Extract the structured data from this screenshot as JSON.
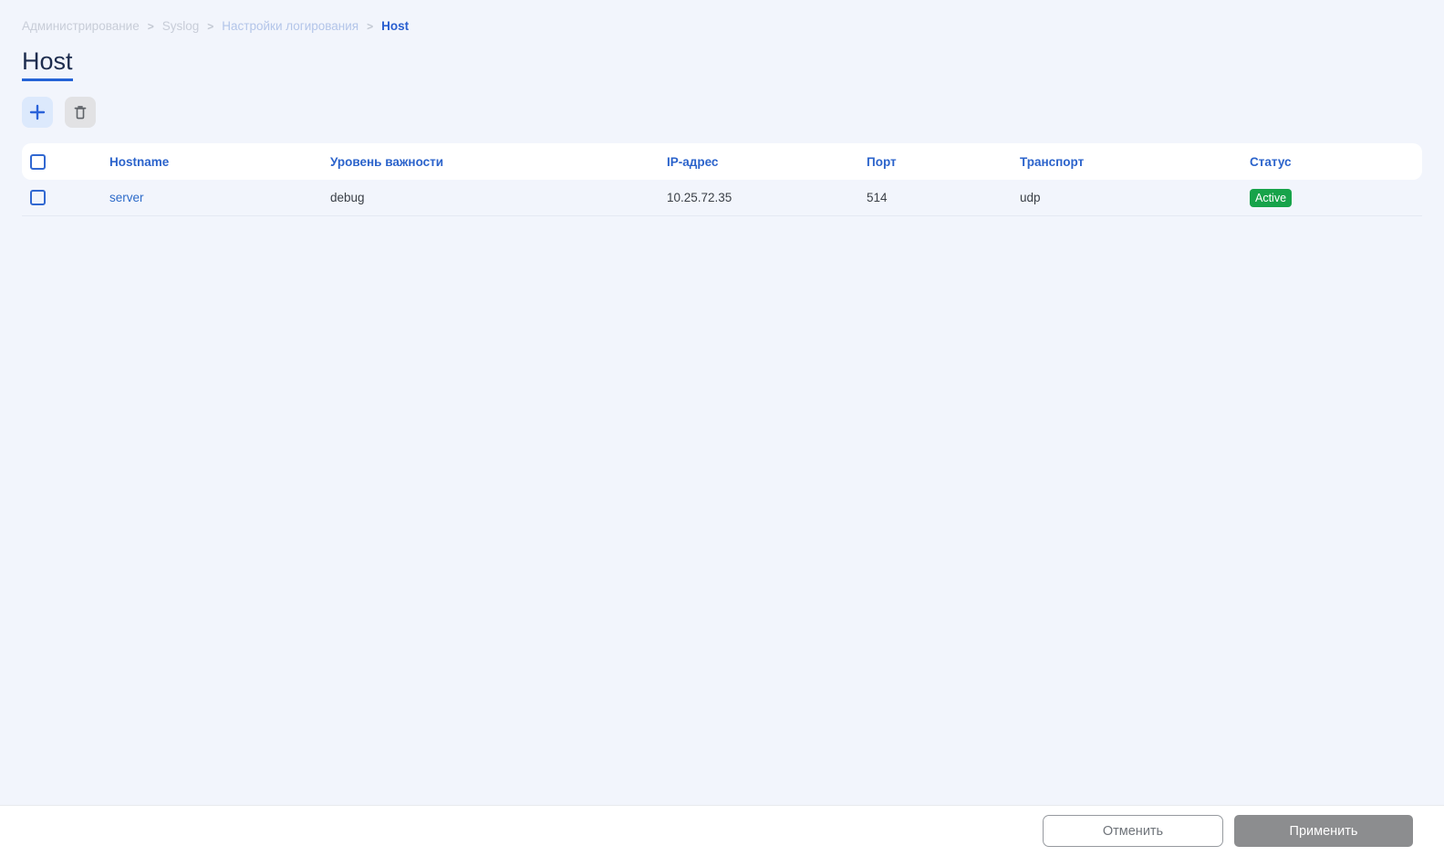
{
  "colors": {
    "accent_blue": "#2a5fd0",
    "badge_green": "#17a34a",
    "page_background": "#f2f5fc"
  },
  "breadcrumb": {
    "separator": ">",
    "items": [
      {
        "label": "Администрирование"
      },
      {
        "label": "Syslog"
      },
      {
        "label": "Настройки логирования"
      },
      {
        "label": "Host"
      }
    ]
  },
  "page": {
    "title": "Host"
  },
  "toolbar": {
    "add_icon": "plus-icon",
    "delete_icon": "trash-icon"
  },
  "table": {
    "columns": [
      "Hostname",
      "Уровень важности",
      "IP-адрес",
      "Порт",
      "Транспорт",
      "Статус"
    ],
    "rows": [
      {
        "hostname": "server",
        "severity": "debug",
        "ip_address": "10.25.72.35",
        "port": "514",
        "transport": "udp",
        "status": "Active"
      }
    ]
  },
  "footer": {
    "cancel_label": "Отменить",
    "apply_label": "Применить"
  }
}
